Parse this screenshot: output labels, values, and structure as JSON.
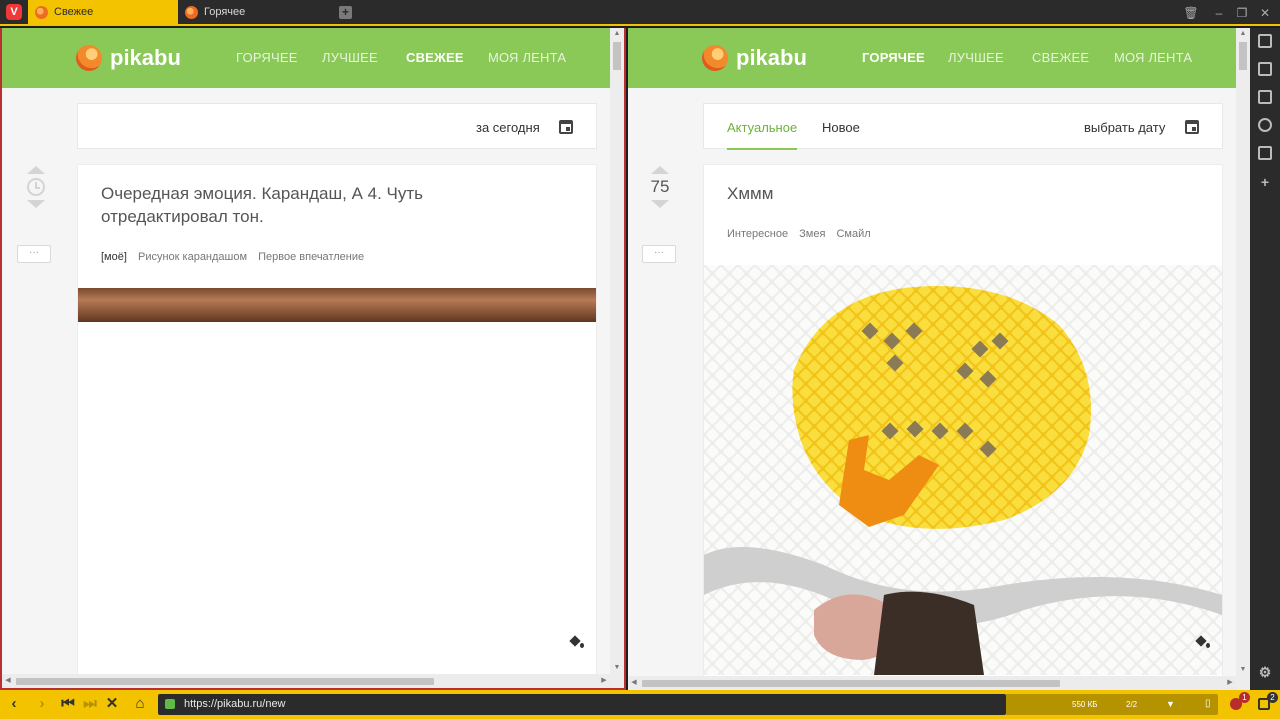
{
  "browser": {
    "tabs": [
      {
        "label": "Свежее",
        "active": true
      },
      {
        "label": "Горячее",
        "active": false
      }
    ],
    "address": "https://pikabu.ru/new",
    "status_size": "550 КБ",
    "status_tabs": "2/2",
    "notif_count_1": "1",
    "notif_count_2": "2",
    "accent": "#f3c300"
  },
  "left": {
    "logo": "pikabu",
    "nav": [
      "ГОРЯЧЕЕ",
      "ЛУЧШЕЕ",
      "СВЕЖЕЕ",
      "МОЯ ЛЕНТА"
    ],
    "filter_label": "за сегодня",
    "post": {
      "title_line1": "Очередная эмоция. Карандаш, А 4. Чуть",
      "title_line2": "отредактировал тон.",
      "tags": [
        "[моё]",
        "Рисунок карандашом",
        "Первое впечатление"
      ]
    },
    "more": "···"
  },
  "right": {
    "logo": "pikabu",
    "nav": [
      "ГОРЯЧЕЕ",
      "ЛУЧШЕЕ",
      "СВЕЖЕЕ",
      "МОЯ ЛЕНТА"
    ],
    "tab_actual": "Актуальное",
    "tab_new": "Новое",
    "date_label": "выбрать дату",
    "post": {
      "rating": "75",
      "title": "Хммм",
      "tags": [
        "Интересное",
        "Змея",
        "Смайл"
      ]
    },
    "more": "···"
  },
  "brand_green": "#8ac858"
}
